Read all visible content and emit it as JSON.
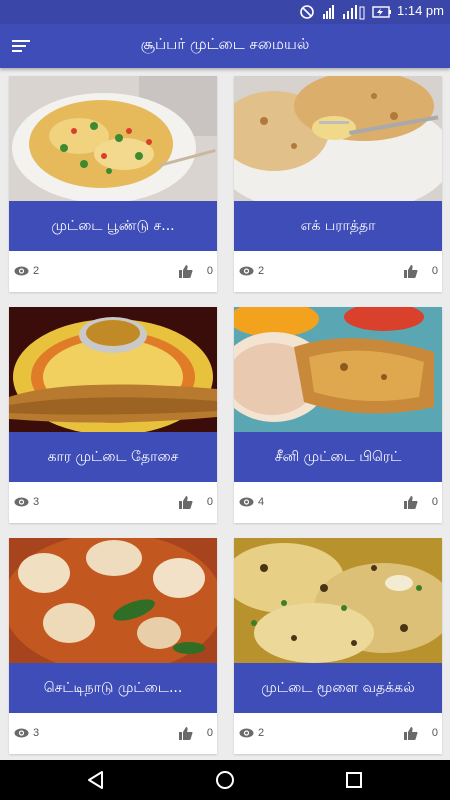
{
  "status_bar": {
    "time": "1:14 pm",
    "icons": [
      "do-not-disturb-icon",
      "signal-icon",
      "signal-icon",
      "battery-charging-icon"
    ]
  },
  "app_bar": {
    "title": "சூப்பர் முட்டை சமையல்",
    "menu_icon": "menu-icon"
  },
  "recipes": [
    {
      "title": "முட்டை பூண்டு ச...",
      "views": "2",
      "likes": "0"
    },
    {
      "title": "எக் பராத்தா",
      "views": "2",
      "likes": "0"
    },
    {
      "title": "கார முட்டை தோசை",
      "views": "3",
      "likes": "0"
    },
    {
      "title": "சீனி முட்டை பிரெட்",
      "views": "4",
      "likes": "0"
    },
    {
      "title": "செட்டிநாடு முட்டை...",
      "views": "3",
      "likes": "0"
    },
    {
      "title": "முட்டை மூளை வதக்கல்",
      "views": "2",
      "likes": "0"
    }
  ],
  "nav_bar": {
    "icons": [
      "back-icon",
      "home-icon",
      "recents-icon"
    ]
  },
  "colors": {
    "primary": "#3f4db8",
    "status_bar": "#3b47a8",
    "background": "#ececec"
  }
}
